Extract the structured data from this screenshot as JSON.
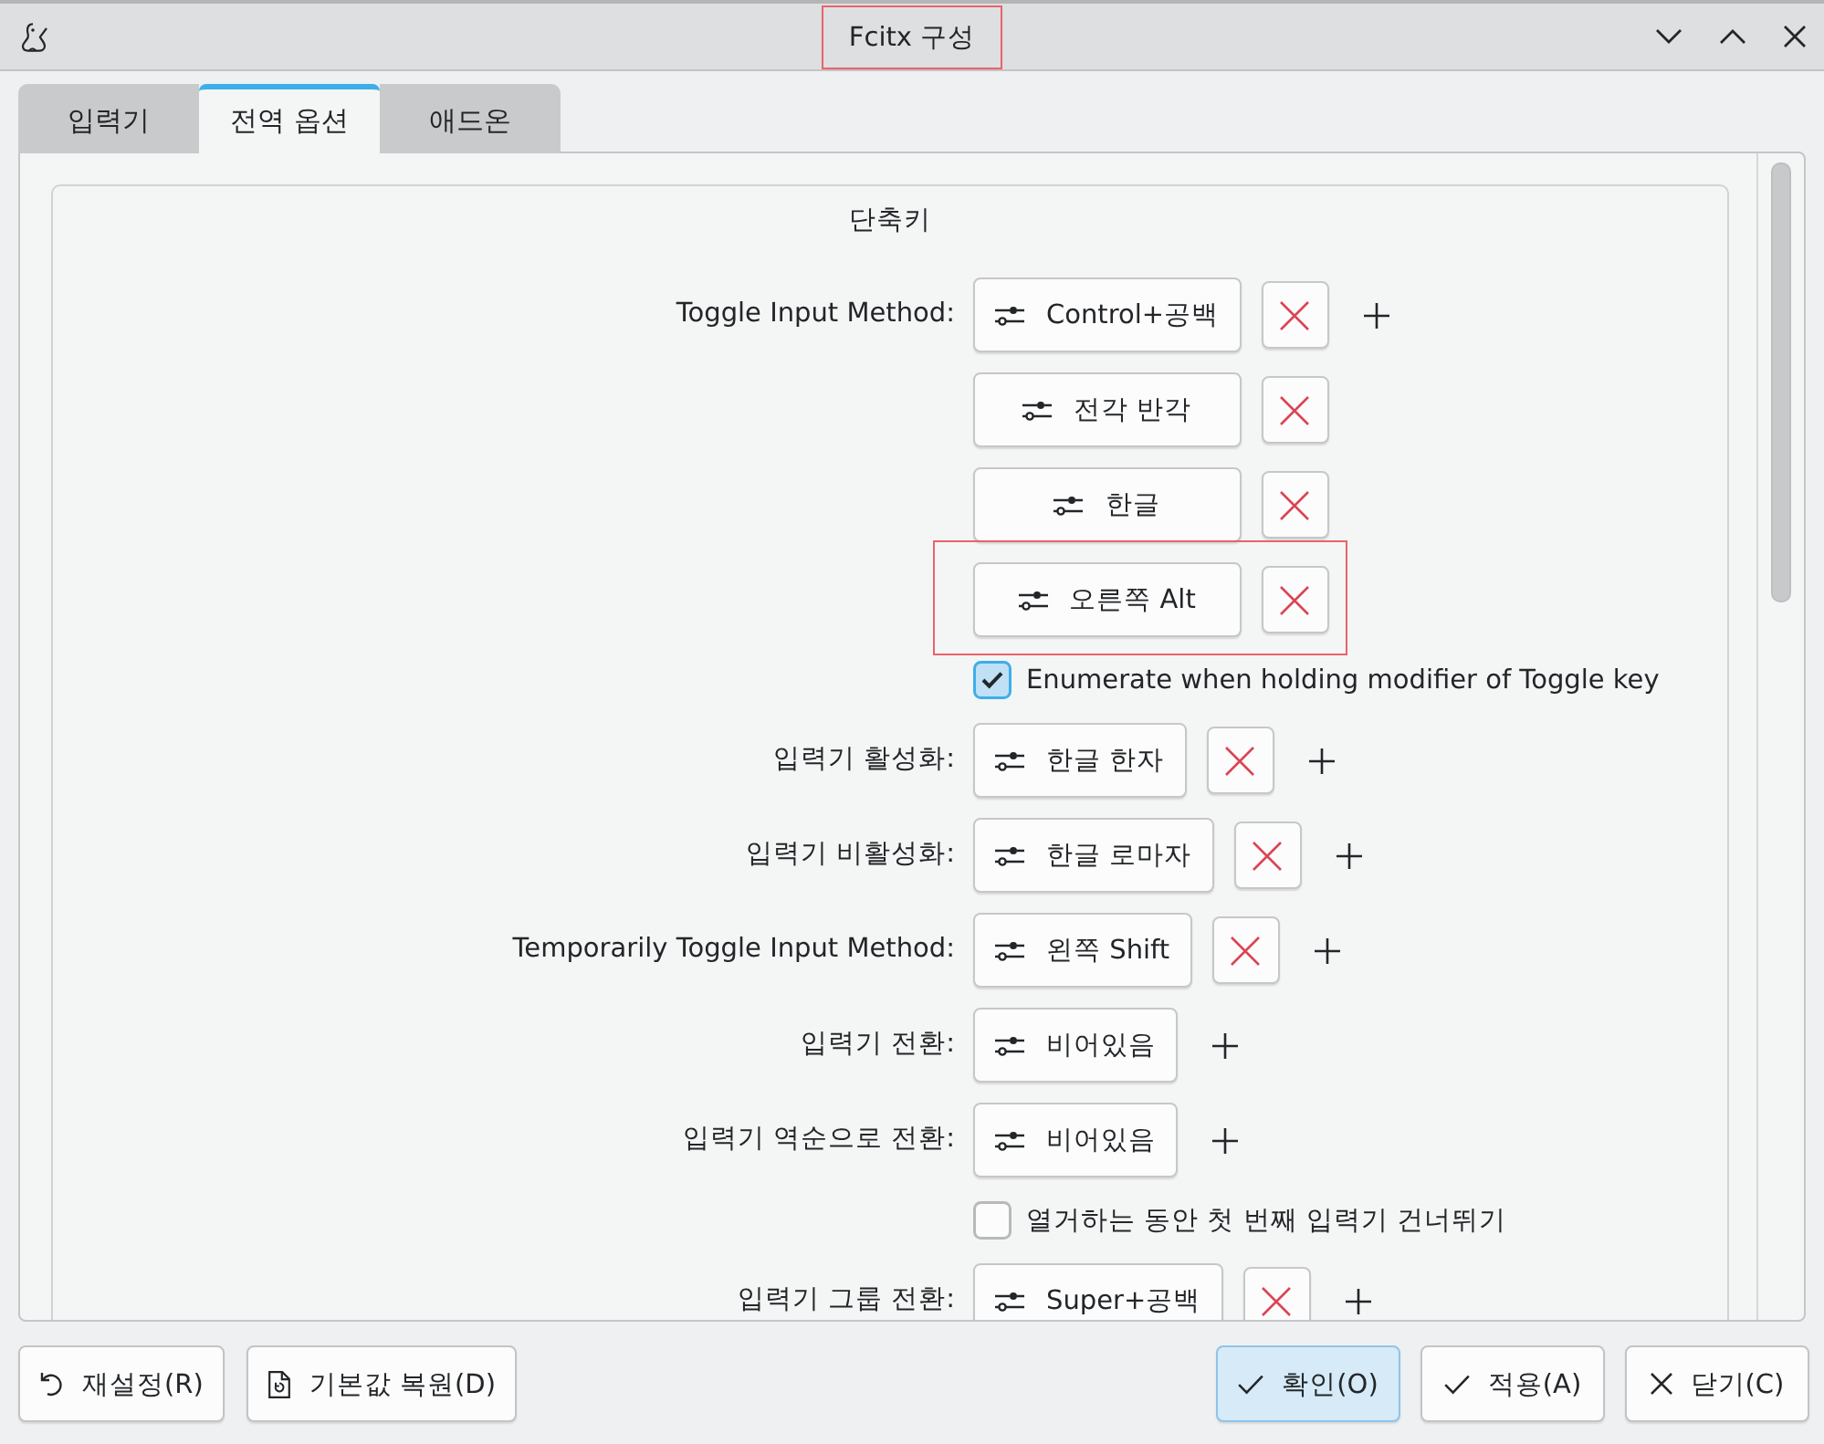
{
  "window": {
    "title": "Fcitx 구성",
    "title_highlighted": true
  },
  "tabs": [
    {
      "label": "입력기",
      "selected": false
    },
    {
      "label": "전역 옵션",
      "selected": true
    },
    {
      "label": "애드온",
      "selected": false
    }
  ],
  "group": {
    "title": "단축키",
    "items": [
      {
        "kind": "shortcut",
        "label": "Toggle Input Method:",
        "keys": [
          {
            "label": "Control+공백",
            "removable": true,
            "highlighted": false
          },
          {
            "label": "전각 반각",
            "removable": true,
            "highlighted": false
          },
          {
            "label": "한글",
            "removable": true,
            "highlighted": false
          },
          {
            "label": "오른쪽 Alt",
            "removable": true,
            "highlighted": true
          }
        ]
      },
      {
        "kind": "checkbox",
        "label": "Enumerate when holding modifier of Toggle key",
        "checked": true
      },
      {
        "kind": "shortcut",
        "label": "입력기 활성화:",
        "keys": [
          {
            "label": "한글 한자",
            "removable": true,
            "highlighted": false
          }
        ]
      },
      {
        "kind": "shortcut",
        "label": "입력기 비활성화:",
        "keys": [
          {
            "label": "한글 로마자",
            "removable": true,
            "highlighted": false
          }
        ]
      },
      {
        "kind": "shortcut",
        "label": "Temporarily Toggle Input Method:",
        "keys": [
          {
            "label": "왼쪽 Shift",
            "removable": true,
            "highlighted": false
          }
        ]
      },
      {
        "kind": "shortcut",
        "label": "입력기 전환:",
        "keys": [
          {
            "label": "비어있음",
            "removable": false,
            "highlighted": false
          }
        ]
      },
      {
        "kind": "shortcut",
        "label": "입력기 역순으로 전환:",
        "keys": [
          {
            "label": "비어있음",
            "removable": false,
            "highlighted": false
          }
        ]
      },
      {
        "kind": "checkbox",
        "label": "열거하는 동안 첫 번째 입력기 건너뛰기",
        "checked": false
      },
      {
        "kind": "shortcut",
        "label": "입력기 그룹 전환:",
        "keys": [
          {
            "label": "Super+공백",
            "removable": true,
            "highlighted": false
          }
        ]
      }
    ]
  },
  "footer": {
    "left_buttons": [
      {
        "kind": "reset",
        "label": "재설정(R)",
        "default": false
      },
      {
        "kind": "defaults",
        "label": "기본값 복원(D)",
        "default": false
      }
    ],
    "right_buttons": [
      {
        "kind": "ok",
        "label": "확인(O)",
        "default": true
      },
      {
        "kind": "apply",
        "label": "적용(A)",
        "default": false
      },
      {
        "kind": "close",
        "label": "닫기(C)",
        "default": false
      }
    ]
  }
}
